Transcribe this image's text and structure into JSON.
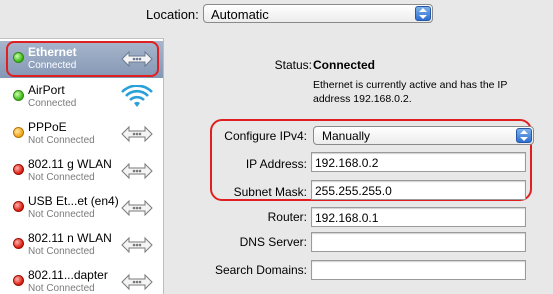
{
  "location": {
    "label": "Location:",
    "value": "Automatic"
  },
  "services": [
    {
      "name": "Ethernet",
      "status": "Connected",
      "dot": "green",
      "icon": "ethernet-icon",
      "selected": true
    },
    {
      "name": "AirPort",
      "status": "Connected",
      "dot": "green",
      "icon": "wifi-icon"
    },
    {
      "name": "PPPoE",
      "status": "Not Connected",
      "dot": "orange",
      "icon": "ethernet-icon"
    },
    {
      "name": "802.11 g WLAN",
      "status": "Not Connected",
      "dot": "red",
      "icon": "ethernet-icon"
    },
    {
      "name": "USB Et...et (en4)",
      "status": "Not Connected",
      "dot": "red",
      "icon": "ethernet-icon"
    },
    {
      "name": "802.11 n WLAN",
      "status": "Not Connected",
      "dot": "red",
      "icon": "ethernet-icon"
    },
    {
      "name": "802.11...dapter",
      "status": "Not Connected",
      "dot": "red",
      "icon": "ethernet-icon"
    }
  ],
  "colors": {
    "dot_green": "#37b512",
    "dot_orange": "#f0a210",
    "dot_red": "#d8180b",
    "highlight_ring": "#e02020",
    "selection": "#8497b5",
    "wifi": "#2a9fd8"
  },
  "detail": {
    "status_label": "Status:",
    "status_value": "Connected",
    "status_desc": "Ethernet is currently active and has the IP address 192.168.0.2.",
    "configure_label": "Configure IPv4:",
    "configure_value": "Manually",
    "ip_label": "IP Address:",
    "ip_value": "192.168.0.2",
    "mask_label": "Subnet Mask:",
    "mask_value": "255.255.255.0",
    "router_label": "Router:",
    "router_value": "192.168.0.1",
    "dns_label": "DNS Server:",
    "dns_value": "",
    "search_label": "Search Domains:",
    "search_value": ""
  }
}
